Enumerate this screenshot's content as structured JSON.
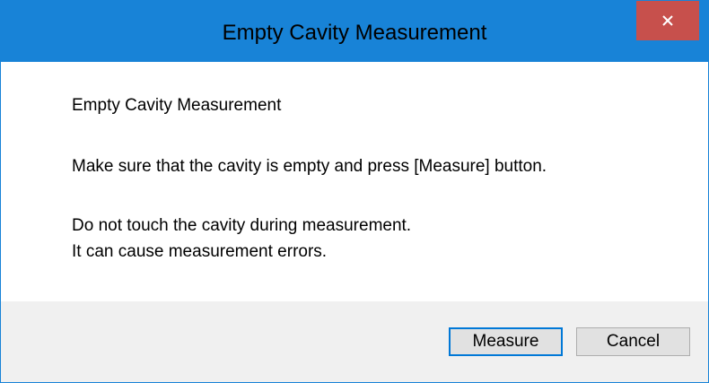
{
  "window": {
    "title": "Empty Cavity Measurement",
    "close_icon": "close-icon",
    "accent_color": "#1883d7",
    "close_color": "#c7504c"
  },
  "message": {
    "heading": "Empty Cavity Measurement",
    "instruction": "Make sure that the cavity is empty and press [Measure] button.",
    "warning": "Do not touch the cavity during measurement.",
    "note": "It can cause measurement errors."
  },
  "buttons": {
    "measure_label": "Measure",
    "cancel_label": "Cancel"
  }
}
